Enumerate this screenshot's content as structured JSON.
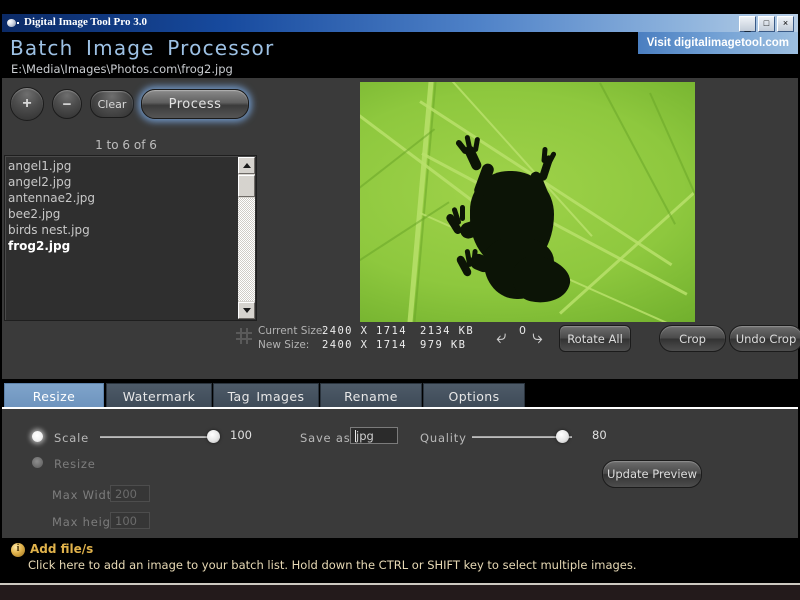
{
  "window": {
    "title": "Digital Image Tool Pro 3.0",
    "icon": "sphere-icon",
    "controls": {
      "minimize": "_",
      "maximize": "□",
      "close": "×"
    }
  },
  "header": {
    "app_title": "Batch Image Processor",
    "file_path": "E:\\Media\\Images\\Photos.com\\frog2.jpg",
    "visit_link": "Visit digitalimagetool.com"
  },
  "toolbar": {
    "add_label": "+",
    "remove_label": "−",
    "clear_label": "Clear",
    "process_label": "Process",
    "count_label": "1 to 6 of 6"
  },
  "filelist": {
    "items": [
      {
        "name": "angel1.jpg",
        "selected": false
      },
      {
        "name": "angel2.jpg",
        "selected": false
      },
      {
        "name": "antennae2.jpg",
        "selected": false
      },
      {
        "name": "bee2.jpg",
        "selected": false
      },
      {
        "name": "birds nest.jpg",
        "selected": false
      },
      {
        "name": "frog2.jpg",
        "selected": true
      }
    ]
  },
  "info": {
    "current_size_label": "Current Size:",
    "new_size_label": "New Size:",
    "current_dimensions": "2400  X  1714",
    "current_filesize": "2134  KB",
    "new_dimensions": "2400  X  1714",
    "new_filesize": "979  KB",
    "rotate_count": "0",
    "rotate_left_icon": "rotate-left-arrow-icon",
    "rotate_right_icon": "rotate-right-arrow-icon",
    "rotate_all_label": "Rotate All",
    "crop_label": "Crop",
    "undo_crop_label": "Undo Crop",
    "grid_icon": "crop-grid-icon"
  },
  "tabs": [
    {
      "label": "Resize",
      "active": true
    },
    {
      "label": "Watermark",
      "active": false
    },
    {
      "label": "Tag Images",
      "active": false
    },
    {
      "label": "Rename",
      "active": false
    },
    {
      "label": "Options",
      "active": false
    }
  ],
  "resize_panel": {
    "scale_label": "Scale",
    "scale_selected": true,
    "scale_value": "100",
    "resize_label": "Resize",
    "resize_selected": false,
    "max_width_label": "Max Width",
    "max_width_value": "200",
    "max_height_label": "Max height",
    "max_height_value": "100",
    "save_as_label": "Save as:",
    "save_as_value": "jpg",
    "quality_label": "Quality",
    "quality_value": "80",
    "update_preview_label": "Update Preview"
  },
  "statusbar": {
    "icon": "info-icon",
    "title": "Add file/s",
    "text": "Click here to add an image to your batch list. Hold down the CTRL or SHIFT key to select multiple images."
  },
  "preview": {
    "alt": "frog silhouette on backlit green leaf"
  },
  "colors": {
    "accent_blue": "#6d93bd",
    "title_blue": "#9dc1e4",
    "panel_gray": "#3a3a3a",
    "status_gold": "#e0b24b"
  }
}
